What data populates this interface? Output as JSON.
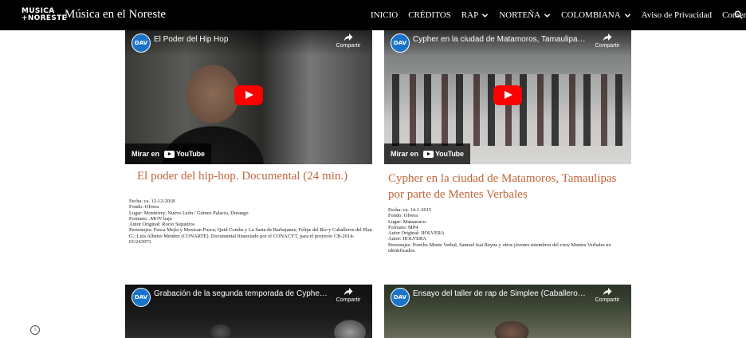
{
  "header": {
    "logo_line1": "MUSICA",
    "logo_line2": "+NORESTE",
    "site_title": "Música en el Noreste",
    "nav": [
      {
        "label": "INICIO",
        "has_dropdown": false
      },
      {
        "label": "CRÉDITOS",
        "has_dropdown": false
      },
      {
        "label": "RAP",
        "has_dropdown": true
      },
      {
        "label": "NORTEÑA",
        "has_dropdown": true
      },
      {
        "label": "COLOMBIANA",
        "has_dropdown": true
      },
      {
        "label": "Aviso de Privacidad",
        "has_dropdown": false
      },
      {
        "label": "Comentarios",
        "has_dropdown": false
      }
    ],
    "search_icon": "search-icon"
  },
  "videos": [
    {
      "channel_badge": "DAV",
      "channel_badge_sub": "CIESAS",
      "title": "El Poder del Hip Hop",
      "share_label": "Compartir",
      "watch_label": "Mirar en",
      "youtube_label": "YouTube"
    },
    {
      "channel_badge": "DAV",
      "channel_badge_sub": "CIESAS",
      "title": "Cypher en la ciudad de Matamoros, Tamaulipas p...",
      "share_label": "Compartir",
      "watch_label": "Mirar en",
      "youtube_label": "YouTube"
    },
    {
      "channel_badge": "DAV",
      "channel_badge_sub": "CIESAS",
      "title": "Grabación de la segunda temporada de Cyphers, ...",
      "share_label": "Compartir"
    },
    {
      "channel_badge": "DAV",
      "channel_badge_sub": "CIESAS",
      "title": "Ensayo del taller de rap de Simplee (Caballeros d...",
      "share_label": "Compartir"
    }
  ],
  "cards": [
    {
      "title": "El poder del hip-hop. Documental (24 min.)",
      "meta": [
        "Fecha: ca. 12-12-2018",
        "Fondo: Olvera",
        "Lugar: Monterrey, Nuevo León / Gómez Palacio, Durango",
        "Formato: .MOV baja",
        "Autor Original: Rocío Siqueiros",
        "Personajes: Fusca Mejía y Mexican Fusca; Quid Comba y La Sarta de Barbajanes; Felipe del Río y Caballeros del Plan G.; Luis Alberto Méndez (CONARTE). Documental financiado por el CONACYT, para el proyecto CB-2014-01/243073"
      ]
    },
    {
      "title": "Cypher en la ciudad de Matamoros, Tamaulipas por parte de Mentes Verbales",
      "meta": [
        "Fecha: ca. 14-1-2015",
        "Fondo: Olvera",
        "Lugar: Matamoros",
        "Formato: MP4",
        "Autor Original: IIOLVERA",
        "Autor: IIOLVERA",
        "Personajes: Poncho Mente Verbal, Samuel Isai Reyna y otros jóvenes miembros del crew Mentes Verbales no identificados."
      ]
    }
  ],
  "colors": {
    "topbar": "#000000",
    "card_title": "#c0653a",
    "play_button": "#ff0000",
    "channel_badge": "#1a73c9"
  },
  "footer": {
    "info_icon": "info-icon"
  }
}
